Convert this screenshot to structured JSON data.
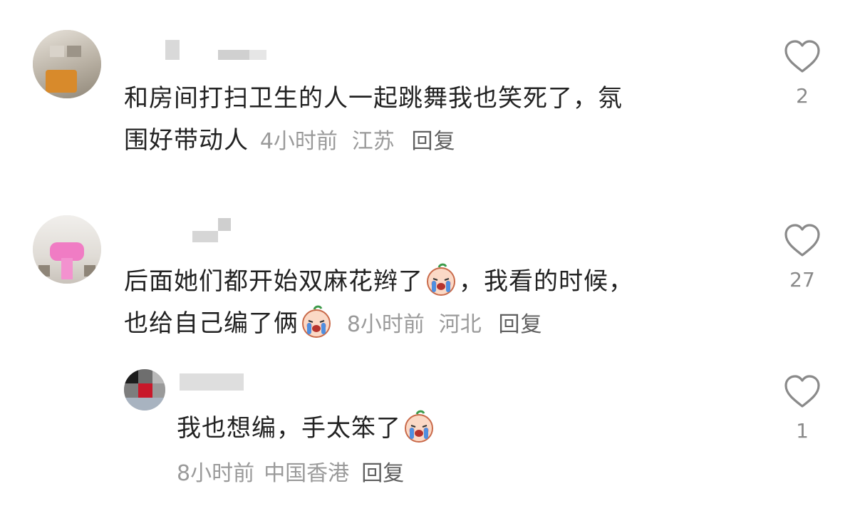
{
  "comments": [
    {
      "username": "",
      "text_line1": "和房间打扫卫生的人一起跳舞我也笑死了，氛",
      "text_line2": "围好带动人",
      "time": "4小时前",
      "location": "江苏",
      "reply_label": "回复",
      "like_count": "2"
    },
    {
      "username": "",
      "text_line1": "后面她们都开始双麻花辫了",
      "text_line1b": "，我看的时候，",
      "text_line2": "也给自己编了俩",
      "time": "8小时前",
      "location": "河北",
      "reply_label": "回复",
      "like_count": "27"
    }
  ],
  "replies": [
    {
      "username": "",
      "text": "我也想编，手太笨了",
      "time": "8小时前",
      "location": "中国香港",
      "reply_label": "回复",
      "like_count": "1"
    }
  ],
  "icons": {
    "like": "heart-outline-icon",
    "emoji": "crying-peach-emoji-icon"
  },
  "colors": {
    "text": "#222222",
    "meta": "#9a9a9a",
    "reply": "#5f5f5f",
    "heart": "#8a8a8a",
    "like_count": "#8a8a8a"
  }
}
